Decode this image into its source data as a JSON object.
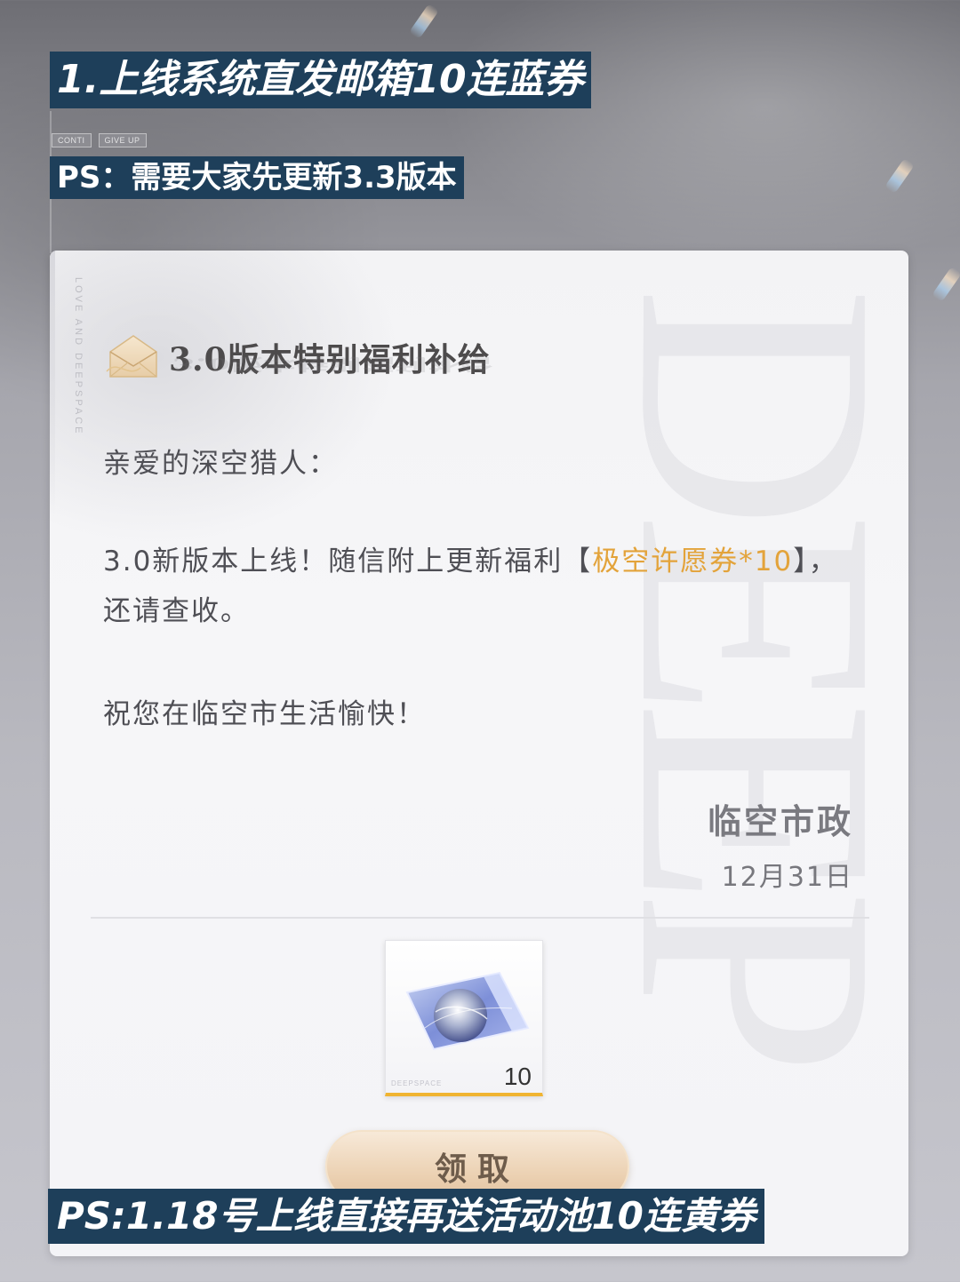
{
  "banners": {
    "top_title": "1.上线系统直发邮箱10连蓝券",
    "top_note": "PS：需要大家先更新3.3版本",
    "bottom_note": "PS:1.18号上线直接再送活动池10连黄券"
  },
  "background": {
    "tags": [
      "CONTI",
      "GIVE UP"
    ]
  },
  "mail": {
    "side_text": "LOVE AND DEEPSPACE",
    "watermark": "DEEP",
    "title": "3.0版本特别福利补给",
    "greeting": "亲爱的深空猎人：",
    "para1_prefix": "3.0新版本上线！随信附上更新福利【",
    "para1_highlight": "极空许愿券*10",
    "para1_suffix": "】，还请查收。",
    "para2": "祝您在临空市生活愉快！",
    "signature": "临空市政",
    "date": "12月31日"
  },
  "reward": {
    "icon": "wish-ticket-icon",
    "count": "10",
    "brand": "DEEPSPACE",
    "highlight_color": "#f0b431"
  },
  "actions": {
    "claim_label": "领取"
  },
  "colors": {
    "banner_bg": "#1e3f5a",
    "highlight": "#e3a33a"
  }
}
